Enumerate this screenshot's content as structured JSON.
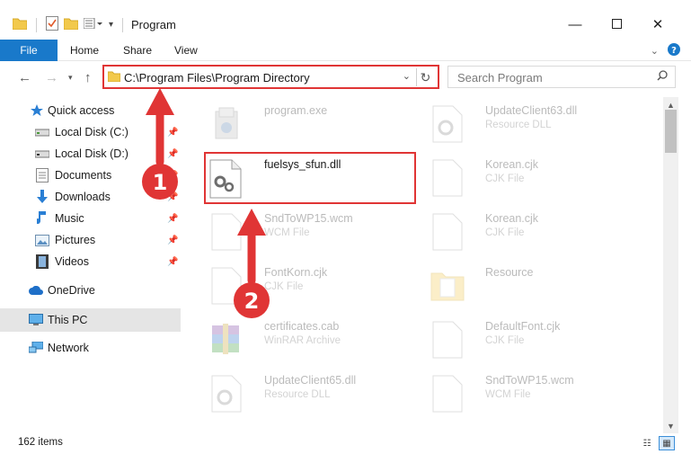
{
  "window": {
    "title": "Program",
    "minimize_icon": "minimize-icon",
    "maximize_icon": "maximize-icon",
    "close_icon": "close-icon"
  },
  "ribbon": {
    "tabs": [
      {
        "label": "File"
      },
      {
        "label": "Home"
      },
      {
        "label": "Share"
      },
      {
        "label": "View"
      }
    ]
  },
  "address": {
    "path": "C:\\Program Files\\Program Directory"
  },
  "search": {
    "placeholder": "Search Program"
  },
  "nav": {
    "items": [
      {
        "label": "Quick access",
        "icon": "star-icon",
        "pinned": false
      },
      {
        "label": "Local Disk (C:)",
        "icon": "drive-icon",
        "pinned": true
      },
      {
        "label": "Local Disk (D:)",
        "icon": "drive-icon",
        "pinned": true
      },
      {
        "label": "Documents",
        "icon": "documents-icon",
        "pinned": true
      },
      {
        "label": "Downloads",
        "icon": "download-icon",
        "pinned": true
      },
      {
        "label": "Music",
        "icon": "music-icon",
        "pinned": true
      },
      {
        "label": "Pictures",
        "icon": "pictures-icon",
        "pinned": true
      },
      {
        "label": "Videos",
        "icon": "videos-icon",
        "pinned": true
      },
      {
        "label": "OneDrive",
        "icon": "cloud-icon",
        "pinned": false
      },
      {
        "label": "This PC",
        "icon": "computer-icon",
        "pinned": false
      },
      {
        "label": "Network",
        "icon": "network-icon",
        "pinned": false
      }
    ]
  },
  "files": [
    {
      "name": "program.exe",
      "type": "",
      "icon": "exe-icon",
      "highlighted": false
    },
    {
      "name": "UpdateClient63.dll",
      "type": "Resource DLL",
      "icon": "dll-icon",
      "highlighted": false
    },
    {
      "name": "fuelsys_sfun.dll",
      "type": "",
      "icon": "dll-gear-icon",
      "highlighted": true
    },
    {
      "name": "Korean.cjk",
      "type": "CJK File",
      "icon": "file-icon",
      "highlighted": false
    },
    {
      "name": "SndToWP15.wcm",
      "type": "WCM File",
      "icon": "file-icon",
      "highlighted": false
    },
    {
      "name": "Korean.cjk",
      "type": "CJK File",
      "icon": "file-icon",
      "highlighted": false
    },
    {
      "name": "FontKorn.cjk",
      "type": "CJK File",
      "icon": "file-icon",
      "highlighted": false
    },
    {
      "name": "Resource",
      "type": "",
      "icon": "folder-icon",
      "highlighted": false
    },
    {
      "name": "certificates.cab",
      "type": "WinRAR Archive",
      "icon": "archive-icon",
      "highlighted": false
    },
    {
      "name": "DefaultFont.cjk",
      "type": "CJK File",
      "icon": "file-icon",
      "highlighted": false
    },
    {
      "name": "UpdateClient65.dll",
      "type": "Resource DLL",
      "icon": "dll-icon",
      "highlighted": false
    },
    {
      "name": "SndToWP15.wcm",
      "type": "WCM File",
      "icon": "file-icon",
      "highlighted": false
    }
  ],
  "status": {
    "item_count": "162 items"
  },
  "annotations": {
    "step1": "1",
    "step2": "2",
    "color": "#e03535"
  }
}
